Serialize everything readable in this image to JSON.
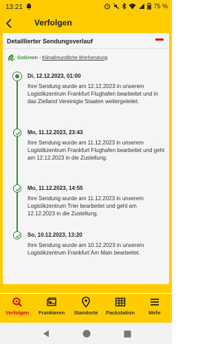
{
  "status_bar": {
    "time": "13:21",
    "battery": "75 %"
  },
  "header": {
    "title": "Verfolgen"
  },
  "card": {
    "title": "Detaillierter Sendungsverlauf",
    "gogreen_brand": "GoGreen",
    "gogreen_separator": "-",
    "gogreen_link": "Klimafreundliche Briefsendung"
  },
  "events": [
    {
      "date": "Di, 12.12.2023, 01:00",
      "text": "Ihre Sendung wurde am 12.12.2023 in unserem Logistikzentrum Frankfurt Flughafen bearbeitet und in das Zielland Vereinigte Staaten weitergeleitet.",
      "state": "current"
    },
    {
      "date": "Mo, 11.12.2023, 23:43",
      "text": "Ihre Sendung wurde am 11.12.2023 in unserem Logistikzentrum Frankfurt Flughafen bearbeitet und geht am 12.12.2023 in die Zustellung.",
      "state": "done"
    },
    {
      "date": "Mo, 11.12.2023, 14:55",
      "text": "Ihre Sendung wurde am 11.12.2023 in unserem Logistikzentrum Trier bearbeitet und geht am 12.12.2023 in die Zustellung.",
      "state": "done"
    },
    {
      "date": "So, 10.12.2023, 13:20",
      "text": "Ihre Sendung wurde am 10.12.2023 in unserem Logistikzentrum Frankfurt Am Main bearbeitet.",
      "state": "done"
    }
  ],
  "bottom_nav": {
    "items": [
      {
        "label": "Verfolgen",
        "icon": "search-icon",
        "active": true
      },
      {
        "label": "Frankieren",
        "icon": "stamp-icon",
        "active": false
      },
      {
        "label": "Standorte",
        "icon": "location-pin-icon",
        "active": false
      },
      {
        "label": "Packstation",
        "icon": "packstation-icon",
        "active": false
      },
      {
        "label": "Mehr",
        "icon": "menu-icon",
        "active": false
      }
    ]
  },
  "colors": {
    "brand_yellow": "#fecc00",
    "brand_red": "#d40511",
    "green": "#3d8b38"
  }
}
